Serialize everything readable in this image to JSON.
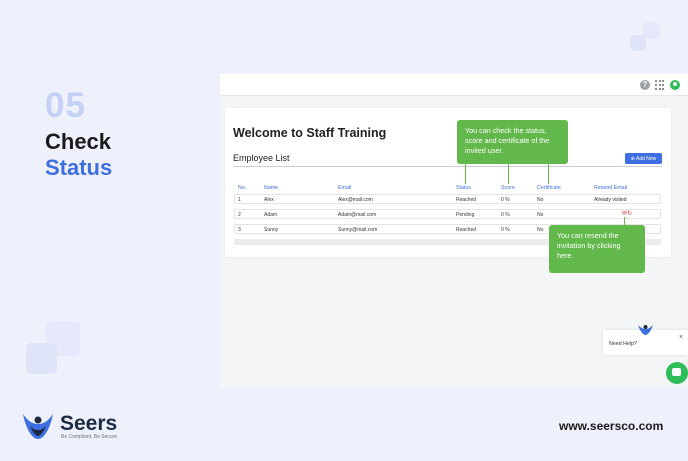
{
  "slide": {
    "step_number": "05",
    "title_line1": "Check",
    "title_line2": "Status"
  },
  "app": {
    "topbar": {
      "help_icon": "question-circle-icon",
      "apps_icon": "grid-icon",
      "user_icon": "user-avatar-icon"
    },
    "heading": "Welcome to Staff Training",
    "section_title": "Employee List",
    "add_button": "⊕ Add New",
    "table": {
      "columns": [
        "No.",
        "Name",
        "Email",
        "Status",
        "Score",
        "Certificate",
        "Resend Email"
      ],
      "rows": [
        {
          "no": "1",
          "name": "Alex",
          "email": "Alex@mail.com",
          "status": "Reached",
          "score": "0 %",
          "certificate": "No",
          "resend": "Already visited"
        },
        {
          "no": "2",
          "name": "Adam",
          "email": "Adam@mail.com",
          "status": "Pending",
          "score": "0 %",
          "certificate": "No",
          "resend": ""
        },
        {
          "no": "3",
          "name": "Sunny",
          "email": "Sunny@mail.com",
          "status": "Reached",
          "score": "0 %",
          "certificate": "No",
          "resend": ""
        }
      ]
    }
  },
  "tooltips": {
    "status_tip": "You can check the status, score and certificate of the invited user.",
    "resend_tip": "You can resend the invitation by clicking here."
  },
  "help_widget": {
    "text": "Need Help?",
    "close": "×"
  },
  "footer": {
    "brand": "Seers",
    "tagline": "Be Compliant, Be Secure",
    "url": "www.seersco.com"
  },
  "colors": {
    "accent": "#3d6fe0",
    "tooltip": "#63b84b",
    "background": "#eef1fb"
  }
}
